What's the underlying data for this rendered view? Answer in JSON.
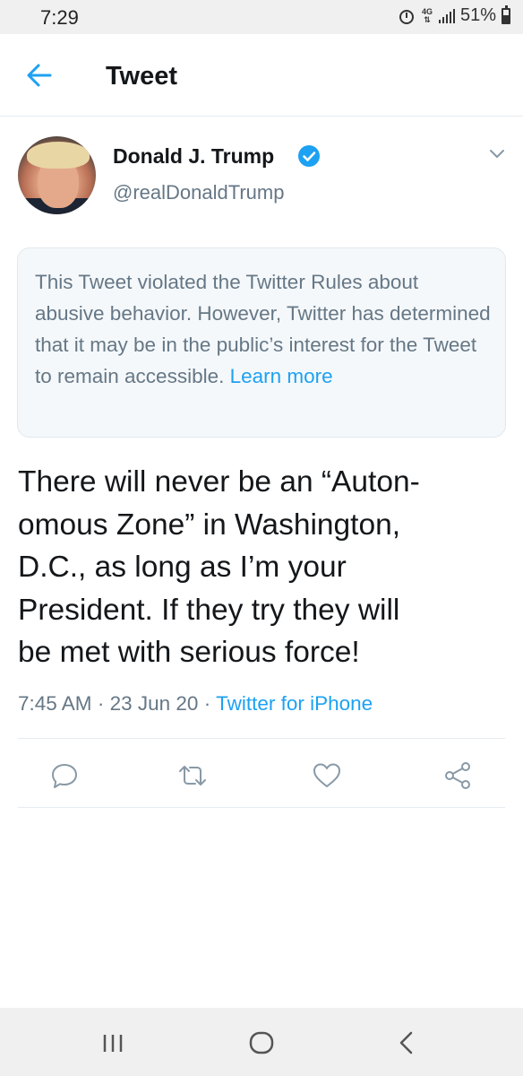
{
  "status_bar": {
    "time": "7:29",
    "network": "4G LTE",
    "battery": "51%"
  },
  "header": {
    "title": "Tweet"
  },
  "author": {
    "name": "Donald J. Trump",
    "handle": "@realDonaldTrump"
  },
  "notice": {
    "text": "This Tweet violated the Twitter Rules about abusive behavior. However, Twitter has determined that it may be in the public’s interest for the Tweet to remain accessible.",
    "link": "Learn more"
  },
  "tweet": {
    "lines": [
      "There will never be an “Auton-",
      "omous Zone” in Washington,",
      "D.C., as long as I’m your",
      "President. If they try they will",
      "be met with serious force!"
    ],
    "time": "7:45 AM",
    "date": "23 Jun 20",
    "separator": "·",
    "source": "Twitter for iPhone"
  },
  "icons": {
    "back": "arrow-left-icon",
    "verified": "verified-badge-icon",
    "more": "chevron-down-icon",
    "reply": "reply-icon",
    "retweet": "retweet-icon",
    "like": "heart-icon",
    "share": "share-icon",
    "recents": "recents-icon",
    "home": "home-icon",
    "nav_back": "nav-back-icon"
  },
  "colors": {
    "accent": "#1da1f2",
    "text": "#14171a",
    "secondary": "#657786",
    "notice_bg": "#f5f8fa"
  }
}
